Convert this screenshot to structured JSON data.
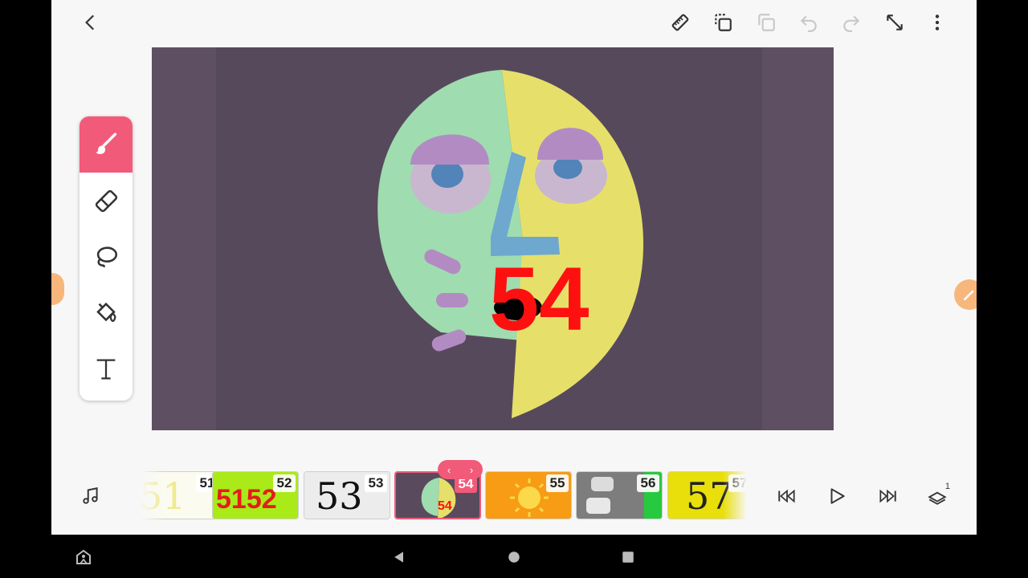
{
  "toolbar": {
    "icons": [
      "back-icon",
      "ruler-icon",
      "duplicate-frame-icon",
      "copy-icon",
      "undo-icon",
      "redo-icon",
      "fullscreen-icon",
      "more-icon"
    ]
  },
  "tools": [
    {
      "name": "brush-tool",
      "icon": "brush-icon",
      "active": true
    },
    {
      "name": "eraser-tool",
      "icon": "eraser-icon",
      "active": false
    },
    {
      "name": "lasso-tool",
      "icon": "lasso-icon",
      "active": false
    },
    {
      "name": "fill-tool",
      "icon": "paint-bucket-icon",
      "active": false
    },
    {
      "name": "text-tool",
      "icon": "text-icon",
      "active": false
    }
  ],
  "canvas": {
    "drawn_text": "54",
    "colors": {
      "background": "#57495c",
      "face_left": "#9fdcb0",
      "face_right": "#e6e06a",
      "nose": "#6ea8cf",
      "eyelid": "#b38bc3",
      "eye_white": "#c9b7cf",
      "pupil": "#5283b9",
      "ink_red": "#ff1010"
    }
  },
  "timeline": {
    "frames": [
      {
        "number": "51",
        "label": "51",
        "bg": "#fbfbf0",
        "color": "#f0ea90",
        "selected": false
      },
      {
        "number": "52",
        "label": "5152",
        "bg": "#a9ea18",
        "color": "#e51c1c",
        "selected": false
      },
      {
        "number": "53",
        "label": "53",
        "bg": "#ececec",
        "color": "#111111",
        "selected": false
      },
      {
        "number": "54",
        "label": "",
        "bg": "#5a4a5e",
        "color": "#ffffff",
        "selected": true
      },
      {
        "number": "55",
        "label": "55",
        "bg": "#f79c14",
        "color": "#fbd94a",
        "selected": false
      },
      {
        "number": "56",
        "label": "",
        "bg": "#7d7d7d",
        "color": "#ffffff",
        "selected": false
      },
      {
        "number": "57",
        "label": "57",
        "bg": "#e8df0b",
        "color": "#222222",
        "selected": false
      }
    ],
    "handle_left": "‹",
    "handle_right": "›"
  },
  "playback": {
    "icons": [
      "music-icon",
      "skip-start-icon",
      "play-icon",
      "skip-end-icon",
      "layers-icon"
    ],
    "layer_count": "1"
  },
  "accent_color": "#f25a7a",
  "system_nav": {
    "icons": [
      "accessibility-icon",
      "nav-back-icon",
      "home-icon",
      "recents-icon"
    ]
  }
}
